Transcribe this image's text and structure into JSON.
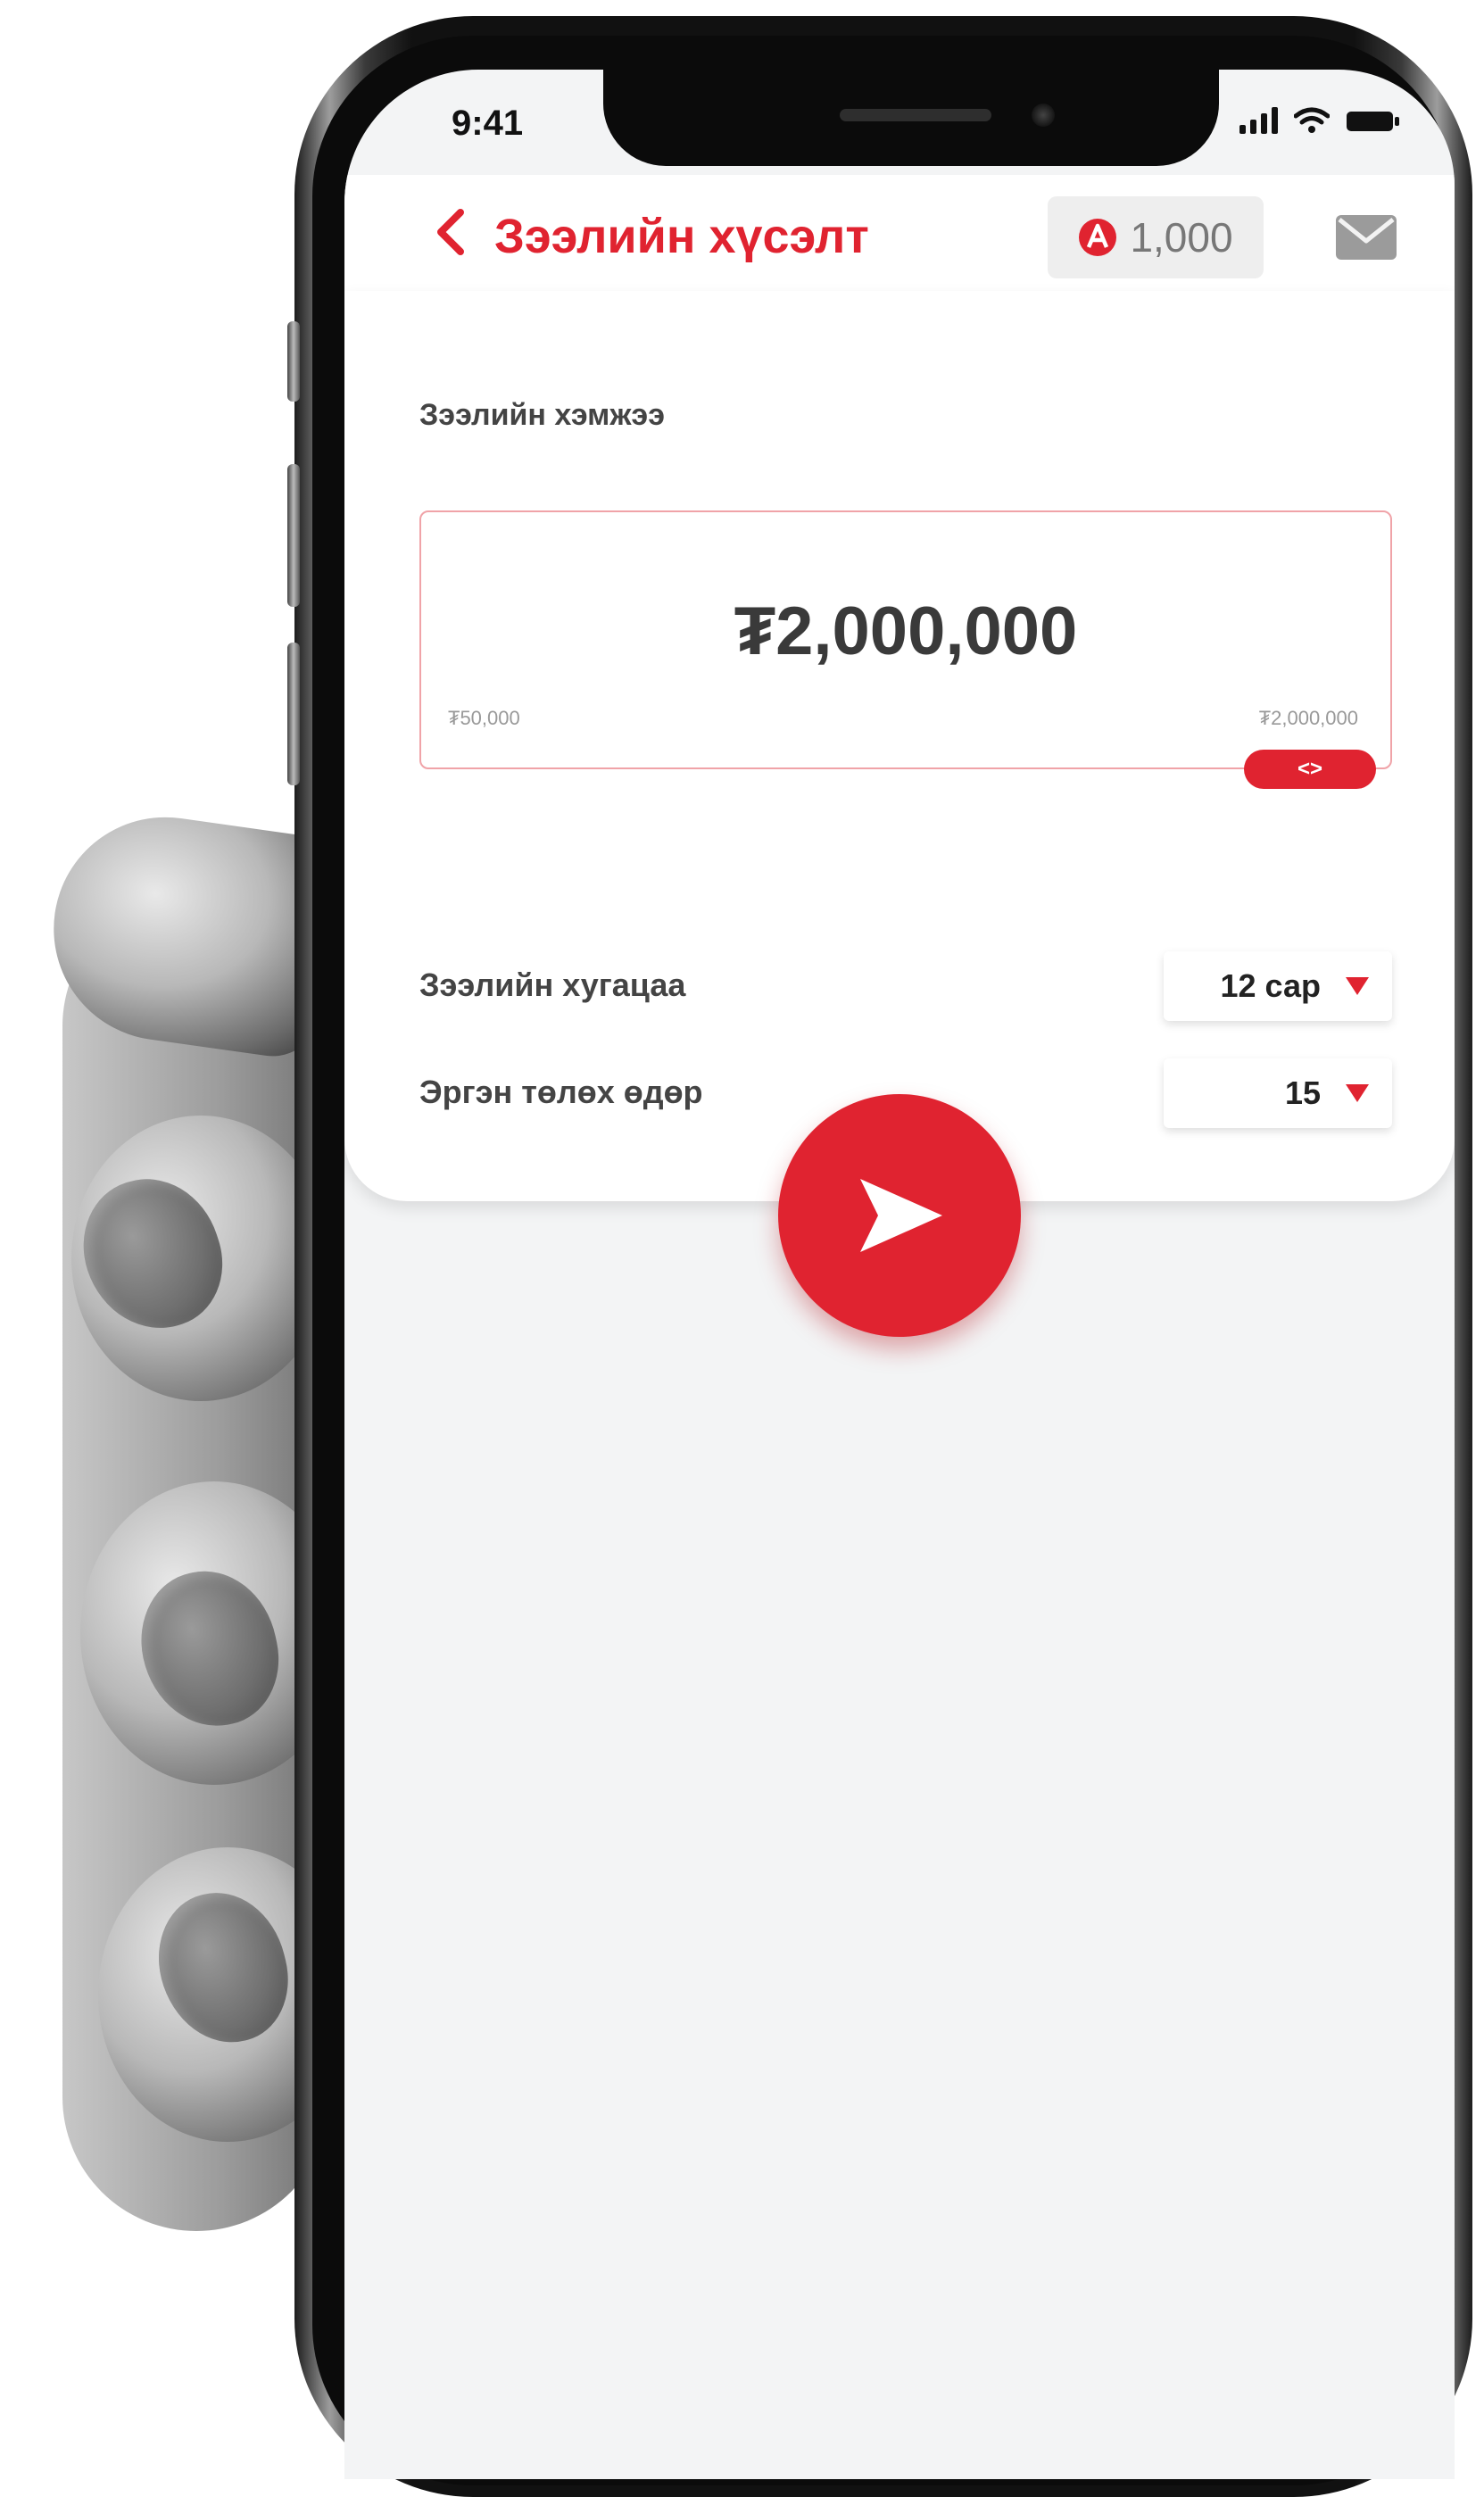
{
  "status_bar": {
    "time": "9:41"
  },
  "header": {
    "back_icon": "chevron-left-icon",
    "title": "Зээлийн хүсэлт",
    "points_icon": "brand-coin-icon",
    "points": "1,000",
    "mail_icon": "mail-icon"
  },
  "loan": {
    "amount_label": "Зээлийн хэмжээ",
    "amount": "₮2,000,000",
    "min": "₮50,000",
    "max": "₮2,000,000",
    "slider_handle": "<>",
    "slider_fraction": 1.0
  },
  "term": {
    "label": "Зээлийн хугацаа",
    "value": "12 сар"
  },
  "repay_day": {
    "label": "Эргэн төлөх өдөр",
    "value": "15"
  },
  "colors": {
    "accent": "#e02330",
    "text": "#3a3a3a",
    "background": "#f3f4f5"
  }
}
